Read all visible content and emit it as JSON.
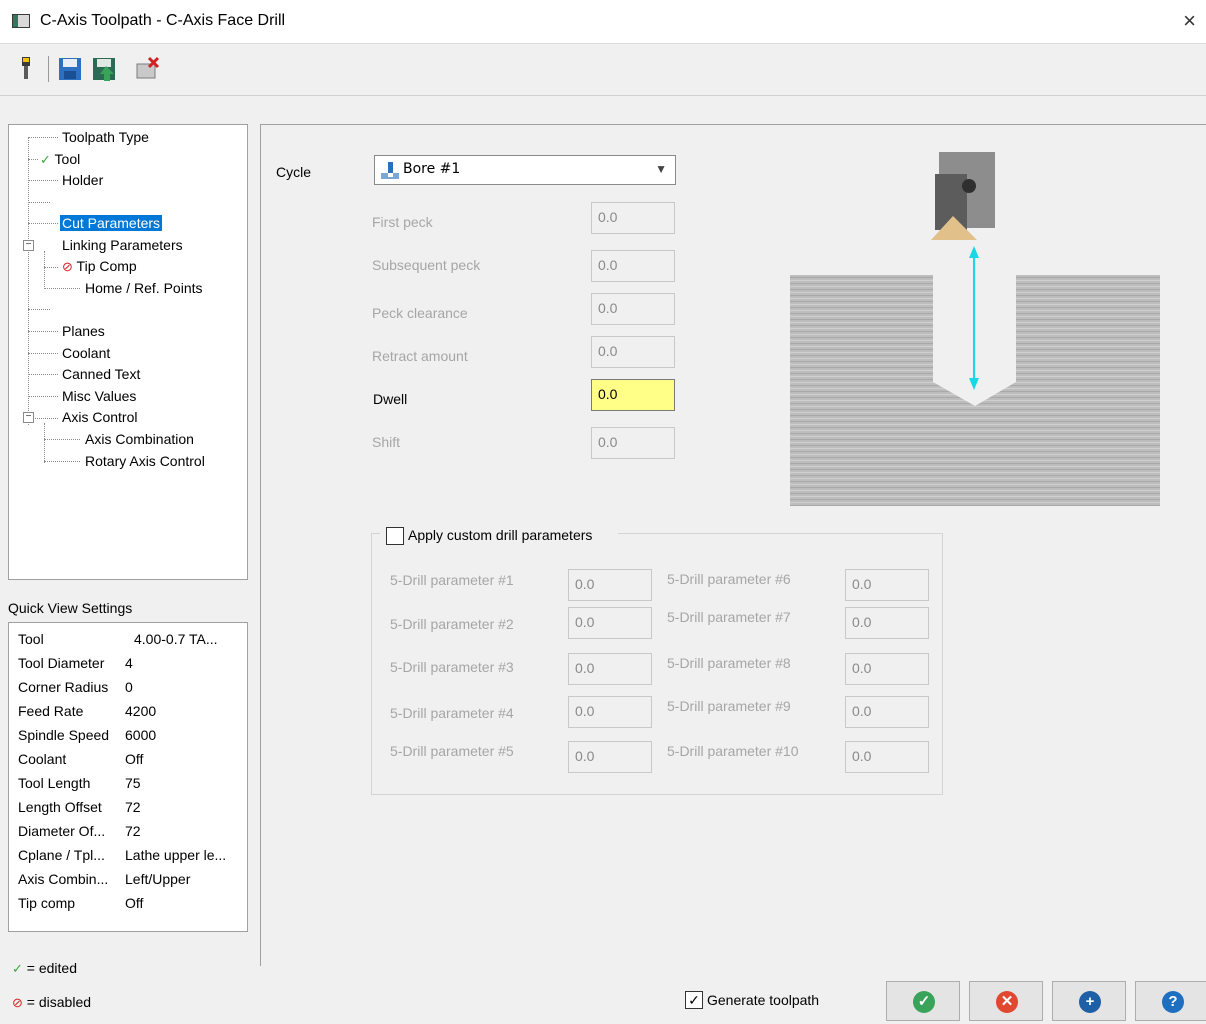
{
  "window": {
    "title": "C-Axis Toolpath - C-Axis Face Drill",
    "close_glyph": "×"
  },
  "toolbar": {
    "icons": [
      "tool-icon",
      "save-icon",
      "save-as-icon",
      "clear-icon"
    ]
  },
  "tree": {
    "items": [
      {
        "label": "Toolpath Type"
      },
      {
        "label": "Tool",
        "status": "edited"
      },
      {
        "label": "Holder"
      },
      {
        "label": "Cut Parameters",
        "selected": true
      },
      {
        "label": "Linking Parameters"
      },
      {
        "label": "Tip Comp",
        "status": "disabled"
      },
      {
        "label": "Home / Ref. Points"
      },
      {
        "label": "Planes"
      },
      {
        "label": "Coolant"
      },
      {
        "label": "Canned Text"
      },
      {
        "label": "Misc Values"
      },
      {
        "label": "Axis Control"
      },
      {
        "label": "Axis Combination"
      },
      {
        "label": "Rotary Axis Control"
      }
    ]
  },
  "quick_view": {
    "title": "Quick View Settings",
    "rows": [
      {
        "label": "Tool",
        "value": "4.00-0.7 TA..."
      },
      {
        "label": "Tool Diameter",
        "value": "4"
      },
      {
        "label": "Corner Radius",
        "value": "0"
      },
      {
        "label": "Feed Rate",
        "value": "4200"
      },
      {
        "label": "Spindle Speed",
        "value": "6000"
      },
      {
        "label": "Coolant",
        "value": "Off"
      },
      {
        "label": "Tool Length",
        "value": "75"
      },
      {
        "label": "Length Offset",
        "value": "72"
      },
      {
        "label": "Diameter Of...",
        "value": "72"
      },
      {
        "label": "Cplane / Tpl...",
        "value": "Lathe upper le..."
      },
      {
        "label": "Axis Combin...",
        "value": "Left/Upper"
      },
      {
        "label": "Tip comp",
        "value": "Off"
      }
    ]
  },
  "legend": {
    "edited": "= edited",
    "disabled": "= disabled"
  },
  "cycle": {
    "label": "Cycle",
    "value": "Bore #1"
  },
  "params": [
    {
      "label": "First peck",
      "value": "0.0"
    },
    {
      "label": "Subsequent peck",
      "value": "0.0"
    },
    {
      "label": "Peck clearance",
      "value": "0.0"
    },
    {
      "label": "Retract amount",
      "value": "0.0"
    },
    {
      "label": "Dwell",
      "value": "0.0",
      "active": true
    },
    {
      "label": "Shift",
      "value": "0.0"
    }
  ],
  "custom": {
    "checkbox_label": "Apply custom drill parameters",
    "checked": false,
    "params": [
      {
        "label": "5-Drill parameter #1",
        "value": "0.0"
      },
      {
        "label": "5-Drill parameter #2",
        "value": "0.0"
      },
      {
        "label": "5-Drill parameter #3",
        "value": "0.0"
      },
      {
        "label": "5-Drill parameter #4",
        "value": "0.0"
      },
      {
        "label": "5-Drill parameter #5",
        "value": "0.0"
      },
      {
        "label": "5-Drill parameter #6",
        "value": "0.0"
      },
      {
        "label": "5-Drill parameter #7",
        "value": "0.0"
      },
      {
        "label": "5-Drill parameter #8",
        "value": "0.0"
      },
      {
        "label": "5-Drill parameter #9",
        "value": "0.0"
      },
      {
        "label": "5-Drill parameter #10",
        "value": "0.0"
      }
    ]
  },
  "footer": {
    "generate_label": "Generate toolpath",
    "generate_checked": true,
    "buttons": [
      {
        "name": "ok",
        "glyph": "✓",
        "color": "#3aa35a"
      },
      {
        "name": "cancel",
        "glyph": "✕",
        "color": "#e0482f"
      },
      {
        "name": "add",
        "glyph": "+",
        "color": "#1f5fa6"
      },
      {
        "name": "help",
        "glyph": "?",
        "color": "#1f6fc0"
      }
    ]
  }
}
